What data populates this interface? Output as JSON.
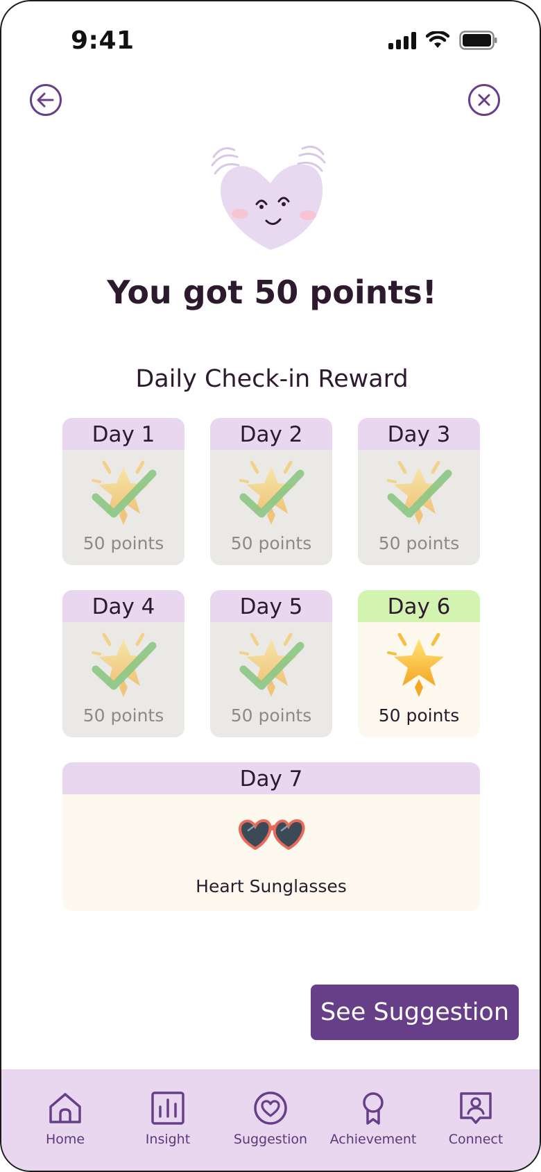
{
  "status_bar": {
    "time": "9:41"
  },
  "headline": "You got 50 points!",
  "section_title": "Daily Check-in Reward",
  "days": [
    {
      "label": "Day 1",
      "points": "50 points",
      "state": "claimed"
    },
    {
      "label": "Day 2",
      "points": "50 points",
      "state": "claimed"
    },
    {
      "label": "Day 3",
      "points": "50 points",
      "state": "claimed"
    },
    {
      "label": "Day 4",
      "points": "50 points",
      "state": "claimed"
    },
    {
      "label": "Day 5",
      "points": "50 points",
      "state": "claimed"
    },
    {
      "label": "Day 6",
      "points": "50 points",
      "state": "current"
    }
  ],
  "day7": {
    "label": "Day 7",
    "reward": "Heart Sunglasses",
    "icon": "heart-sunglasses-icon"
  },
  "cta": {
    "label": "See Suggestion"
  },
  "tabbar": {
    "items": [
      {
        "label": "Home",
        "icon": "home-icon"
      },
      {
        "label": "Insight",
        "icon": "bar-chart-icon"
      },
      {
        "label": "Suggestion",
        "icon": "heart-circle-icon"
      },
      {
        "label": "Achievement",
        "icon": "award-icon"
      },
      {
        "label": "Connect",
        "icon": "user-chat-icon"
      }
    ]
  },
  "colors": {
    "primary": "#673e88",
    "header_lavender": "#e9d6ef",
    "current_green": "#d3f4b0",
    "claimed_card": "#ebe9e5",
    "active_card": "#fdf9ee",
    "check_green": "#8cc784"
  }
}
